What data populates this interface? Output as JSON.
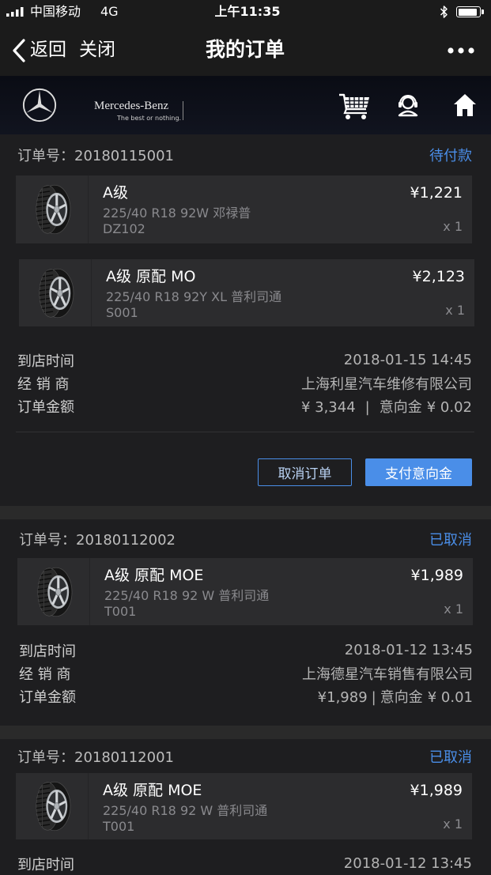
{
  "status_bar": {
    "signal_icon": "signal-bars-icon",
    "carrier": "中国移动",
    "network": "4G",
    "time": "上午11:35",
    "bluetooth_icon": "bluetooth-icon",
    "battery_icon": "battery-icon",
    "battery_level": 0.9
  },
  "nav": {
    "back_icon": "chevron-left-icon",
    "back_label": "返回",
    "close_label": "关闭",
    "title": "我的订单",
    "more_icon": "more-dots-icon"
  },
  "brand": {
    "logo_icon": "mercedes-star-icon",
    "name": "Mercedes-Benz",
    "tagline": "The best or nothing.",
    "cart_icon": "shopping-cart-icon",
    "service_icon": "customer-service-icon",
    "home_icon": "home-icon"
  },
  "labels": {
    "order_no": "订单号：",
    "arrival_time": "到店时间",
    "dealer": "经 销 商",
    "order_amount": "订单金额",
    "deposit": "意向金",
    "amount_separator": "|"
  },
  "orders": [
    {
      "order_no": "20180115001",
      "status": "待付款",
      "items": [
        {
          "thumb_icon": "tire-icon",
          "name": "A级",
          "spec": "225/40 R18 92W 邓禄普",
          "code": "DZ102",
          "price": "¥1,221",
          "qty": "x 1"
        },
        {
          "thumb_icon": "tire-icon",
          "name": "A级 原配 MO",
          "spec": "225/40 R18 92Y XL 普利司通",
          "code": "S001",
          "price": "¥2,123",
          "qty": "x 1"
        }
      ],
      "arrival_time": "2018-01-15 14:45",
      "dealer": "上海利星汽车维修有限公司",
      "amount": "¥ 3,344",
      "deposit_amount": "¥ 0.02",
      "actions": {
        "cancel": "取消订单",
        "pay_deposit": "支付意向金"
      }
    },
    {
      "order_no": "20180112002",
      "status": "已取消",
      "items": [
        {
          "thumb_icon": "tire-icon",
          "name": "A级 原配 MOE",
          "spec": "225/40 R18 92 W 普利司通",
          "code": "T001",
          "price": "¥1,989",
          "qty": "x 1"
        }
      ],
      "arrival_time": "2018-01-12 13:45",
      "dealer": "上海德星汽车销售有限公司",
      "amount": "¥1,989",
      "deposit_amount": "¥ 0.01"
    },
    {
      "order_no": "20180112001",
      "status": "已取消",
      "items": [
        {
          "thumb_icon": "tire-icon",
          "name": "A级 原配 MOE",
          "spec": "225/40 R18 92 W 普利司通",
          "code": "T001",
          "price": "¥1,989",
          "qty": "x 1"
        }
      ],
      "arrival_time": "2018-01-12 13:45"
    }
  ],
  "colors": {
    "accent": "#4a8ee8",
    "card": "#1e1e20",
    "tile": "#2c2c2e"
  }
}
